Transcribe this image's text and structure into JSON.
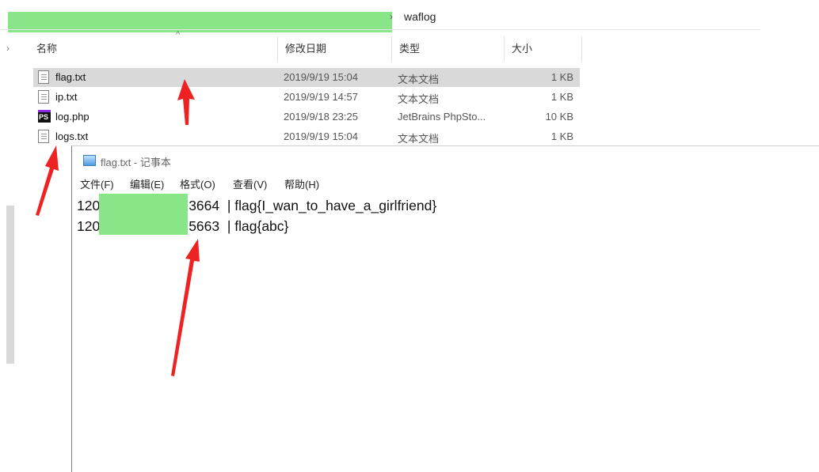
{
  "explorer": {
    "address": {
      "folder": "waflog"
    },
    "columns": {
      "name": "名称",
      "date": "修改日期",
      "type": "类型",
      "size": "大小"
    },
    "files": [
      {
        "name": "flag.txt",
        "date": "2019/9/19 15:04",
        "type": "文本文档",
        "size": "1 KB",
        "icon": "text-file-icon",
        "selected": true
      },
      {
        "name": "ip.txt",
        "date": "2019/9/19 14:57",
        "type": "文本文档",
        "size": "1 KB",
        "icon": "text-file-icon"
      },
      {
        "name": "log.php",
        "date": "2019/9/18 23:25",
        "type": "JetBrains PhpSto...",
        "size": "10 KB",
        "icon": "phpstorm-file-icon"
      },
      {
        "name": "logs.txt",
        "date": "2019/9/19 15:04",
        "type": "文本文档",
        "size": "1 KB",
        "icon": "text-file-icon"
      }
    ]
  },
  "notepad": {
    "title": "flag.txt - 记事本",
    "menu": [
      "文件(F)",
      "编辑(E)",
      "格式(O)",
      "查看(V)",
      "帮助(H)"
    ],
    "lines": [
      {
        "prefix": "120",
        "suffix": "3664  | flag{I_wan_to_have_a_girlfriend}"
      },
      {
        "prefix": "120",
        "suffix": "5663  | flag{abc}"
      }
    ]
  },
  "colors": {
    "redaction": "#88e688",
    "arrow": "#ee2222",
    "selection": "#d9d9d9"
  }
}
